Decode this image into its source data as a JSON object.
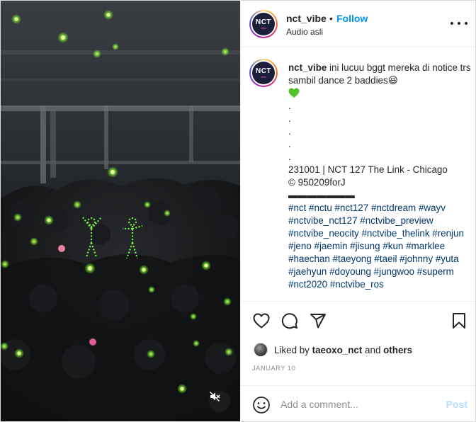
{
  "post": {
    "username": "nct_vibe",
    "follow_label": "Follow",
    "dot": "•",
    "audio_label": "Audio asli",
    "avatar_text_main": "NCT",
    "avatar_text_sub": "vibe"
  },
  "caption": {
    "username": "nct_vibe",
    "text_line1": " ini lucuu bggt mereka di notice trs sambil dance 2 baddies😆",
    "dots": [
      ".",
      ".",
      ".",
      ".",
      "."
    ],
    "event_line": "231001 | NCT 127 The Link - Chicago",
    "credit_line": "© 950209forJ",
    "divider_line": "▬▬▬▬▬▬▬",
    "hashtags": [
      "#nct",
      "#nctu",
      "#nct127",
      "#nctdream",
      "#wayv",
      "#nctvibe_nct127",
      "#nctvibe_preview",
      "#nctvibe_neocity",
      "#nctvibe_thelink",
      "#renjun",
      "#jeno",
      "#jaemin",
      "#jisung",
      "#kun",
      "#marklee",
      "#haechan",
      "#taeyong",
      "#taeil",
      "#johnny",
      "#yuta",
      "#jaehyun",
      "#doyoung",
      "#jungwoo",
      "#superm",
      "#nct2020",
      "#nctvibe_ros"
    ]
  },
  "likes": {
    "prefix": "Liked by ",
    "user": "taeoxo_nct",
    "connector": " and ",
    "others": "others"
  },
  "date": "JANUARY 10",
  "comment": {
    "placeholder": "Add a comment...",
    "post_label": "Post"
  },
  "icons": [
    "heart-icon",
    "comment-icon",
    "share-icon",
    "bookmark-icon",
    "emoji-icon",
    "mute-icon",
    "more-icon",
    "green-heart-icon"
  ],
  "colors": {
    "accent": "#0095f6",
    "hashtag": "#00376b",
    "post_disabled": "#b2dffc",
    "secondary_text": "#8e8e8e",
    "glow_green": "#9dff4a"
  }
}
